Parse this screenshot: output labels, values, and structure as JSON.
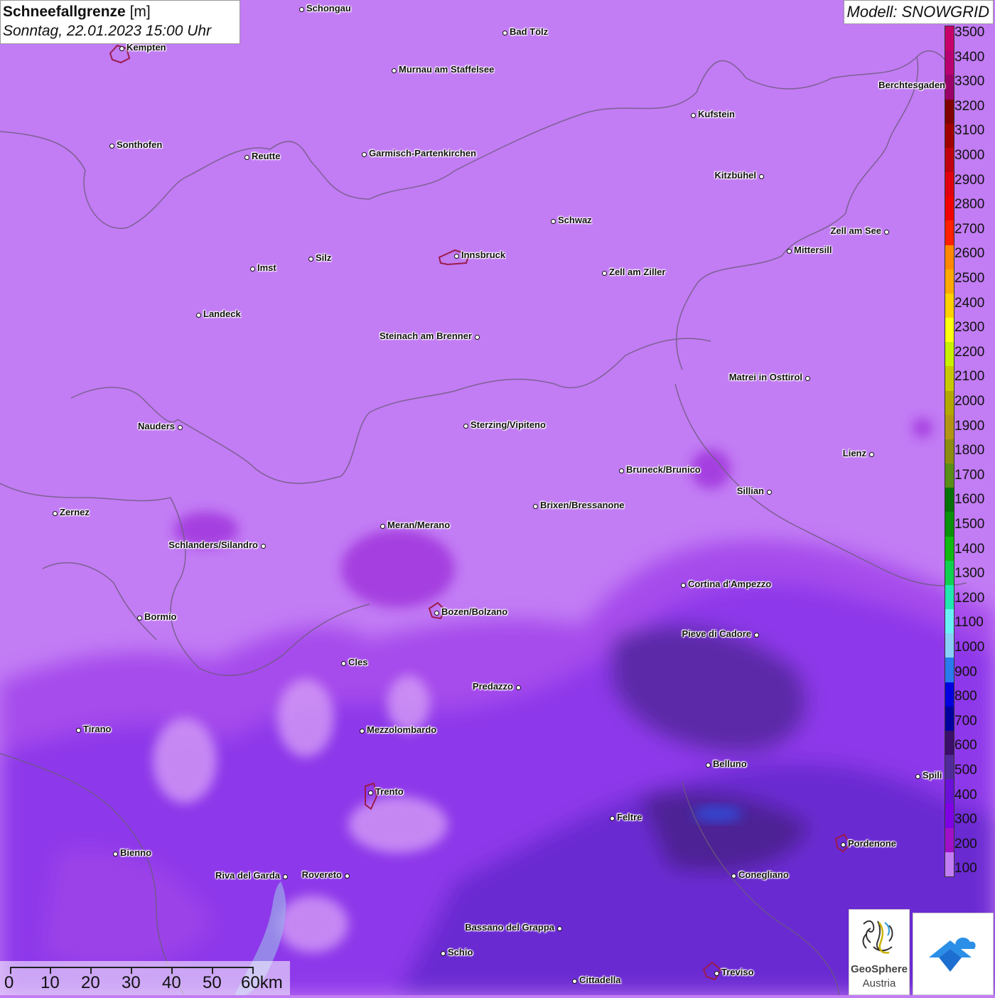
{
  "header": {
    "title": "Schneefallgrenze",
    "unit": "[m]",
    "datetime": "Sonntag, 22.01.2023 15:00 Uhr"
  },
  "model": {
    "label": "Modell: SNOWGRID"
  },
  "legend": {
    "labels": [
      "3500",
      "3400",
      "3300",
      "3200",
      "3100",
      "3000",
      "2900",
      "2800",
      "2700",
      "2600",
      "2500",
      "2400",
      "2300",
      "2200",
      "2100",
      "2000",
      "1900",
      "1800",
      "1700",
      "1600",
      "1500",
      "1400",
      "1300",
      "1200",
      "1100",
      "1000",
      "900",
      "800",
      "700",
      "600",
      "500",
      "400",
      "300",
      "200",
      "100"
    ],
    "colors": [
      "#c27cf4",
      "#a010c8",
      "#8000e6",
      "#6a10d8",
      "#502a9a",
      "#3a0e6a",
      "#0000a0",
      "#0000e0",
      "#2a7af0",
      "#8ad0f8",
      "#6cf0f8",
      "#20e8b0",
      "#10d050",
      "#10b810",
      "#0a900a",
      "#087008",
      "#5a8c18",
      "#8c8c10",
      "#b49414",
      "#b4a800",
      "#c8c800",
      "#c8f000",
      "#ffff10",
      "#ffd000",
      "#ffa800",
      "#ff8800",
      "#ff2000",
      "#f00000",
      "#e00010",
      "#c00010",
      "#a00000",
      "#800000",
      "#9a0068",
      "#b80070",
      "#c8006a"
    ]
  },
  "cities": [
    {
      "name": "Schongau",
      "dot": "left"
    },
    {
      "name": "Bad Tölz",
      "dot": "left"
    },
    {
      "name": "Kempten",
      "dot": "left"
    },
    {
      "name": "Murnau am Staffelsee",
      "dot": "left"
    },
    {
      "name": "Berchtesgaden",
      "dot": "none"
    },
    {
      "name": "Kufstein",
      "dot": "left"
    },
    {
      "name": "Sonthofen",
      "dot": "left"
    },
    {
      "name": "Reutte",
      "dot": "left"
    },
    {
      "name": "Garmisch-Partenkirchen",
      "dot": "left"
    },
    {
      "name": "Kitzbühel",
      "dot": "right"
    },
    {
      "name": "Schwaz",
      "dot": "left"
    },
    {
      "name": "Zell am See",
      "dot": "right"
    },
    {
      "name": "Innsbruck",
      "dot": "left"
    },
    {
      "name": "Mittersill",
      "dot": "left"
    },
    {
      "name": "Imst",
      "dot": "left"
    },
    {
      "name": "Silz",
      "dot": "left"
    },
    {
      "name": "Zell am Ziller",
      "dot": "left"
    },
    {
      "name": "Landeck",
      "dot": "left"
    },
    {
      "name": "Steinach am Brenner",
      "dot": "right"
    },
    {
      "name": "Matrei in Osttirol",
      "dot": "right"
    },
    {
      "name": "Nauders",
      "dot": "right"
    },
    {
      "name": "Sterzing/Vipiteno",
      "dot": "left"
    },
    {
      "name": "Lienz",
      "dot": "right"
    },
    {
      "name": "Bruneck/Brunico",
      "dot": "left"
    },
    {
      "name": "Sillian",
      "dot": "right"
    },
    {
      "name": "Zernez",
      "dot": "left"
    },
    {
      "name": "Brixen/Bressanone",
      "dot": "left"
    },
    {
      "name": "Meran/Merano",
      "dot": "left"
    },
    {
      "name": "Schlanders/Silandro",
      "dot": "right"
    },
    {
      "name": "Cortina d'Ampezzo",
      "dot": "left"
    },
    {
      "name": "Bozen/Bolzano",
      "dot": "left"
    },
    {
      "name": "Bormio",
      "dot": "left"
    },
    {
      "name": "Pieve di Cadore",
      "dot": "right"
    },
    {
      "name": "Cles",
      "dot": "left"
    },
    {
      "name": "Predazzo",
      "dot": "right"
    },
    {
      "name": "Tirano",
      "dot": "left"
    },
    {
      "name": "Mezzolombardo",
      "dot": "left"
    },
    {
      "name": "Belluno",
      "dot": "left"
    },
    {
      "name": "Spili",
      "dot": "left"
    },
    {
      "name": "Trento",
      "dot": "left"
    },
    {
      "name": "Feltre",
      "dot": "left"
    },
    {
      "name": "Pordenone",
      "dot": "left"
    },
    {
      "name": "Bienno",
      "dot": "left"
    },
    {
      "name": "Riva del Garda",
      "dot": "right"
    },
    {
      "name": "Rovereto",
      "dot": "right"
    },
    {
      "name": "Conegliano",
      "dot": "left"
    },
    {
      "name": "Bassano del Grappa",
      "dot": "right"
    },
    {
      "name": "Schio",
      "dot": "left"
    },
    {
      "name": "Treviso",
      "dot": "left"
    },
    {
      "name": "Cittadella",
      "dot": "left"
    }
  ],
  "scalebar": {
    "labels": [
      "0",
      "10",
      "20",
      "30",
      "40",
      "50",
      "60km"
    ]
  },
  "logos": {
    "geosphere_line1": "GeoSphere",
    "geosphere_line2": "Austria",
    "geosphere_icon": "geosphere-logo-icon",
    "app_icon": "weather-app-logo-icon"
  }
}
